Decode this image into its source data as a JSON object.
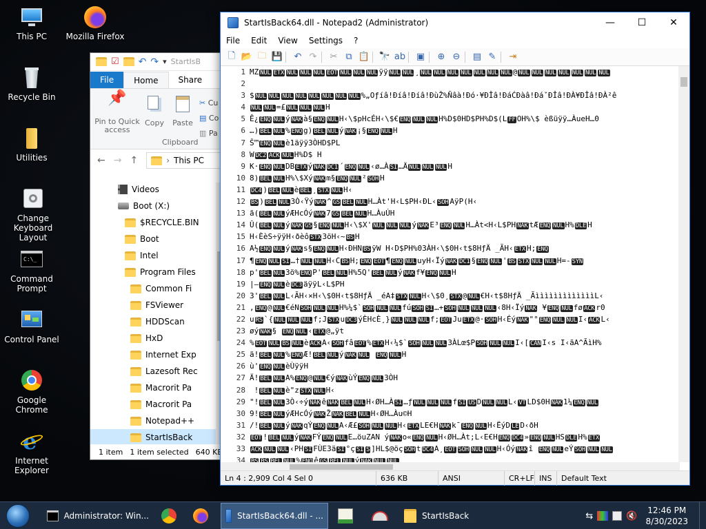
{
  "desktop": {
    "icons": [
      {
        "id": "this-pc",
        "label": "This PC"
      },
      {
        "id": "firefox",
        "label": "Mozilla Firefox"
      },
      {
        "id": "recycle",
        "label": "Recycle Bin"
      },
      {
        "id": "utilities",
        "label": "Utilities"
      },
      {
        "id": "keyboard",
        "label": "Change Keyboard Layout"
      },
      {
        "id": "cmd",
        "label": "Command Prompt"
      },
      {
        "id": "control",
        "label": "Control Panel"
      },
      {
        "id": "chrome",
        "label": "Google Chrome"
      },
      {
        "id": "ie",
        "label": "Internet Explorer"
      }
    ]
  },
  "explorer": {
    "title_fragment": "StartIsB",
    "tabs": [
      "File",
      "Home",
      "Share"
    ],
    "ribbon": {
      "pin": "Pin to Quick access",
      "copy": "Copy",
      "paste": "Paste",
      "cut_fragment": "Cu",
      "copy_path_fragment": "Co",
      "paste_shortcut_fragment": "Pa",
      "group": "Clipboard"
    },
    "address": "This PC",
    "tree": [
      {
        "label": "Videos",
        "kind": "video",
        "indent": 40
      },
      {
        "label": "Boot (X:)",
        "kind": "drive",
        "indent": 40
      },
      {
        "label": "$RECYCLE.BIN",
        "kind": "folder",
        "indent": 50
      },
      {
        "label": "Boot",
        "kind": "folder",
        "indent": 50
      },
      {
        "label": "Intel",
        "kind": "folder",
        "indent": 50
      },
      {
        "label": "Program Files",
        "kind": "folder",
        "indent": 50
      },
      {
        "label": "Common Fi",
        "kind": "folder",
        "indent": 58
      },
      {
        "label": "FSViewer",
        "kind": "folder",
        "indent": 58
      },
      {
        "label": "HDDScan",
        "kind": "folder",
        "indent": 58
      },
      {
        "label": "HxD",
        "kind": "folder",
        "indent": 58
      },
      {
        "label": "Internet Exp",
        "kind": "folder",
        "indent": 58
      },
      {
        "label": "Lazesoft Rec",
        "kind": "folder",
        "indent": 58
      },
      {
        "label": "Macrorit Pa",
        "kind": "folder",
        "indent": 58
      },
      {
        "label": "Macrorit Pa",
        "kind": "folder",
        "indent": 58
      },
      {
        "label": "Notepad++",
        "kind": "folder",
        "indent": 58
      },
      {
        "label": "StartIsBack",
        "kind": "folder",
        "indent": 58,
        "selected": true
      }
    ],
    "status": {
      "items": "1 item",
      "selected": "1 item selected",
      "size": "640 KB"
    }
  },
  "notepad": {
    "title": "StartIsBack64.dll - Notepad2 (Administrator)",
    "menu": [
      "File",
      "Edit",
      "View",
      "Settings",
      "?"
    ],
    "lines": [
      {
        "n": "1",
        "t": "MZ[NUL][ETX][NUL][NUL][NUL][EOT][NUL][NUL][NUL]ÿÿ[NUL][NUL]¸[NUL][NUL][NUL][NUL][NUL][NUL][NUL]@[NUL][NUL][NUL][NUL][NUL][NUL][NUL]"
      },
      {
        "n": "2",
        "t": ""
      },
      {
        "n": "3",
        "t": "$[NUL][NUL][NUL][NUL][NUL][NUL][NUL][NUL]%„Oƒíâ!Đíâ!Đíâ!ĐùŽ%Ñâà!Đó·¥ĐÎâ!ĐáĆÐàâ!ĐáˇĐÎâ!ĐÀ¥ĐÎâ!ĐÀ²ê"
      },
      {
        "n": "4",
        "t": "[NUL][NUL]=£[NUL][NUL][NUL]H"
      },
      {
        "n": "5",
        "t": "Ê¿[ENQ][NUL]ý[NAK]à§[ENQ][NUL]H‹\\$pHcÉH‹\\$€[ENQ][NUL][NUL]H%D$0HD$PH%D$(L[FF]OH%\\$ èßüÿÿ…ÀueH…0"
      },
      {
        "n": "6",
        "t": "…)[BEL][NUL]%[ENQ]g)[BEL][NUL]ý[NAK]¡§[ENQ][NUL]H"
      },
      {
        "n": "7",
        "t": "Š™[ENQ][NUL]è1äÿÿ3ÒHD$PL"
      },
      {
        "n": "8",
        "t": "W[DC2][ACK][NUL]H%D$ H"
      },
      {
        "n": "9",
        "t": "K·[ENQ][NUL]DB[ETX]ý[NAK][DC1]´[ENQ][NUL]‹ø…À[SI]…Ä[NUL][NUL][NUL]H"
      },
      {
        "n": "10",
        "t": "8)[BEL][NUL]H%\\$Xý[NAK]m§[ENQ][NUL]²[SOH]H"
      },
      {
        "n": "11",
        "t": "[DC4])[BEL][NUL]è[BEL]¸[STX][NUL]H‹"
      },
      {
        "n": "12",
        "t": "[BS])[BEL][NUL]3Ò‹Ÿý[NAK]^[GS][BEL][NUL]H…Àt'H‹L$PH‹ÐL‹[SOH]AÿP(H‹"
      },
      {
        "n": "13",
        "t": "ã([BEL][NUL]ýÆHcÓý[NAK]7[GS][BEL][NUL]H…ÀuÚH"
      },
      {
        "n": "14",
        "t": "Û([BEL][NUL]ý[NAK][GS]§[ENQ][NUL]H‹\\$X'[NUL][NUL][NUL]ý[NAK]E³[ENQ][NUL]H…Àt<H‹L$PH[NAK]tÆ[ENQ][NUL]H%[DLE]H"
      },
      {
        "n": "15",
        "t": "H‹ÈèS÷ÿÿH‹ðèô[STX]3öH‹~[BS]H"
      },
      {
        "n": "16",
        "t": "A½[ENQ][NUL]ý[NAK]s§[ENQ][NUL]H‹ÐHN[BS]ÿW H‹D$PH%03ÀH‹\\$0H‹t$8HƒÄ _ÃH‹[ETX]H;[ENQ]"
      },
      {
        "n": "17",
        "t": "¶[ENQ][NUL][SI]…†[NUL][NUL]H‹C[BS]H;[ENQ][EOT]¶[ENQ][NUL]uyH‹Ïý[NAK][DC1]§[ENQ][NUL]'[BS][STX][NUL][NUL]H=-[SYN]"
      },
      {
        "n": "18",
        "t": "p'[BEL][NUL]3ö%[ENQ]P'[BEL][NUL]H%5Q'[BEL][NUL]ý[NAK]f¥[ENQ][NUL]H"
      },
      {
        "n": "19",
        "t": "|—[ENQ][NUL]è[DC3]äÿÿL‹L$PH"
      },
      {
        "n": "20",
        "t": "3'[BEL][NUL]L‹ÃH‹×H‹\\$0H‹t$8HƒÄ _éA‡[STX][NUL]H‹\\$0¸[STX]@[NUL]€H‹t$8HƒÄ _ÃìììììììììììììL‹"
      },
      {
        "n": "21",
        "t": ",[ENQ]@[NUL]€éN[SOH][NUL][NUL]H%¼$`[SOH][NUL][NUL]fú[SOH][SI]…+[SOH][NUL][NUL][NUL]‹8H‹Ïý[NAK] ¥[ENQ][NUL]fø[ACK]r0"
      },
      {
        "n": "22",
        "t": "u[RS]`{[NUL][NUL][NUL]f;J[STX]u[DC3]ýÈHcÈ¸}[NUL][NUL][NUL]f;[EOT]Ju[ETX]@·[SOH]H‹Éý[NAK]\"°[ENQ][NUL][NUL]I‹[ACK]L‹"
      },
      {
        "n": "23",
        "t": "øý[NAK]§ [ENQ][NUL]‹[ETX]@„ÿt"
      },
      {
        "n": "24",
        "t": "%[EOT][NUL][BS][NUL]è[ACK]A‹[SOH]fâ[EOT]%[ETX]H‹¼$`[SOH][NUL][NUL]3ÀLœ$P[SOH][NUL][NUL]I‹[[CAN]I‹s I‹ãA^ÃìH%"
      },
      {
        "n": "25",
        "t": "ä![BEL][NUL]%[ENQ]Æ![BEL][NUL]ý[NAK][NUL] [ENQ][NUL]H"
      },
      {
        "n": "26",
        "t": "ù'[ENQ][NUL]èÙÿÿH"
      },
      {
        "n": "27",
        "t": "Ä![BEL][NUL]A%[ENQ]@[NUL]€ý[NAK]ùÝ[ENQ][NUL]3ÒH"
      },
      {
        "n": "28",
        "t": " ![BEL][NUL]è\"z[STX][NUL]H‹"
      },
      {
        "n": "29",
        "t": "\"![BEL][NUL]3Ò‹÷ý[NAK]ê[NAK][BEL][NUL]H‹ØH…À[SI]…ƒ[NUL][NUL][NUL]f[SI][US]D[NUL][NUL]L‹[VT]LD$0H[NAK]1¼[ENQ][NUL]"
      },
      {
        "n": "30",
        "t": "9![BEL][NUL]ýÆHcÓý[NAK]Ž[NAK][BEL][NUL]H‹ØH…Àu©H"
      },
      {
        "n": "31",
        "t": "/![BEL][NUL]ý[NAK]qÝ[ENQ][NUL]A‹Æ£[SOH][NUL][NUL]H‹[ETX]LE€H[NAK]k¯[ENQ][NUL]H‹ËýD[LE]D‹ðH"
      },
      {
        "n": "32",
        "t": "[EOT]![BEL][NUL]ý[NAK]FÝ[ENQ][NUL]E…öuZAN ý[NAK]o«[ENQ][NUL]H‹ØH…Àt;L‹E€H[ENQ][DC4]»[ENQ][NUL]HS[DLE]H%[ETX]"
      },
      {
        "n": "33",
        "t": "[ACK][NUL][NUL]‹PH[SI]FÙE3ä[SI]°ç[SI][S]]HL$@öç[SOH]t[DC4]A¸[EOT][SOH][NUL][NUL]H‹Óý[NAK]î [ENQ][NUL]eÝ[SOH][NUL][NUL]"
      },
      {
        "n": "34",
        "t": "[BS][BS][BEL][NUL]%[ENQ]ê[GS][BEL][NUL]ý[NAK][NUL][NUL]"
      }
    ],
    "status": {
      "position": "Ln 4 : 2,909   Col 4   Sel 0",
      "size": "636 KB",
      "encoding": "ANSI",
      "eol": "CR+LF",
      "ins": "INS",
      "scheme": "Default Text"
    }
  },
  "taskbar": {
    "items": [
      {
        "id": "cmd",
        "label": "Administrator: Win..."
      },
      {
        "id": "chrome",
        "label": ""
      },
      {
        "id": "firefox",
        "label": ""
      },
      {
        "id": "notepad",
        "label": "StartIsBack64.dll - ...",
        "active": true
      },
      {
        "id": "app5",
        "label": ""
      },
      {
        "id": "app6",
        "label": ""
      },
      {
        "id": "explorer",
        "label": "StartIsBack"
      }
    ],
    "time": "12:46 PM",
    "date": "8/30/2023"
  }
}
